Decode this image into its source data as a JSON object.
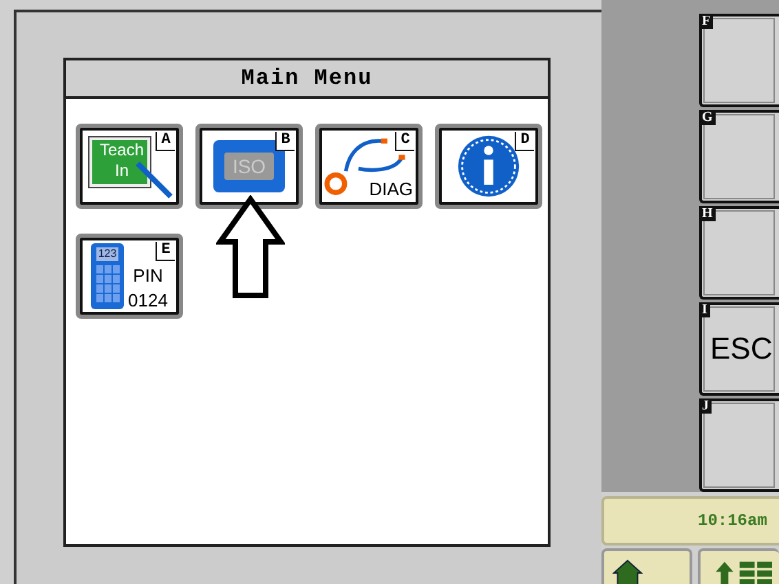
{
  "menu": {
    "title": "Main Menu",
    "tiles": [
      {
        "key": "A",
        "kind": "teach",
        "lines": [
          "Teach",
          "In"
        ]
      },
      {
        "key": "B",
        "kind": "iso",
        "lines": [
          "ISO"
        ]
      },
      {
        "key": "C",
        "kind": "diag",
        "lines": [
          "DIAG"
        ]
      },
      {
        "key": "D",
        "kind": "info"
      },
      {
        "key": "E",
        "kind": "pin",
        "lines": [
          "123",
          "PIN",
          "0124"
        ]
      }
    ]
  },
  "softkeys": [
    {
      "key": "F"
    },
    {
      "key": "G"
    },
    {
      "key": "H"
    },
    {
      "key": "I",
      "label": "ESC"
    },
    {
      "key": "J"
    }
  ],
  "status": {
    "time": "10:16am"
  }
}
